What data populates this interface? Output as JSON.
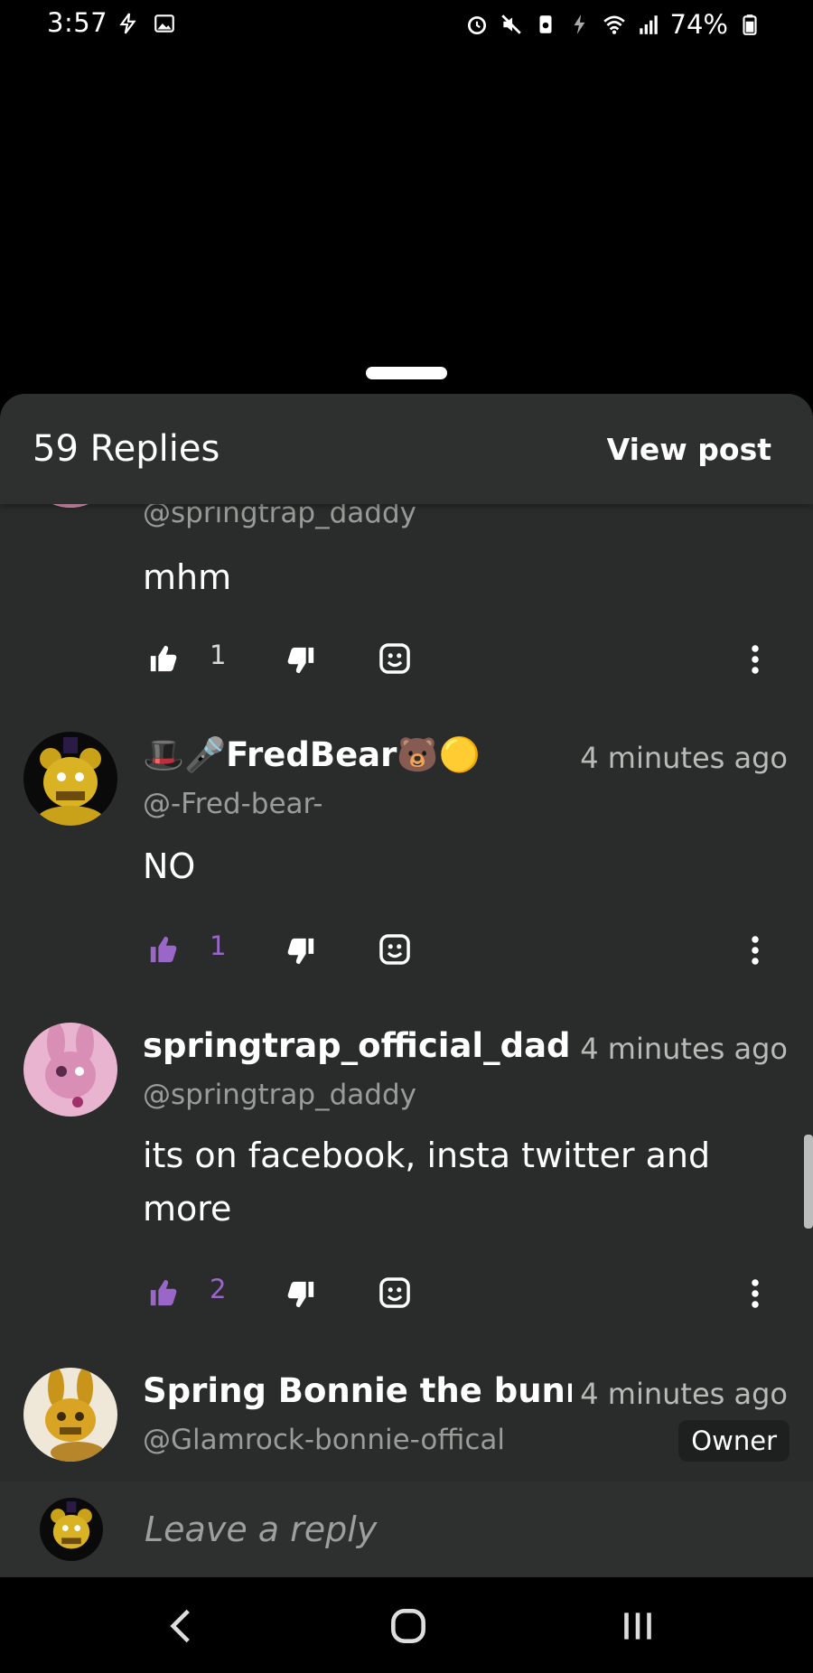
{
  "status_bar": {
    "time": "3:57",
    "battery": "74%"
  },
  "header": {
    "replies_count": "59 Replies",
    "view_post": "View post"
  },
  "comments": [
    {
      "name": "",
      "handle": "@springtrap_daddy",
      "time": "",
      "body": "mhm",
      "likes": "1",
      "liked": false
    },
    {
      "name": "🎩🎤FredBear🐻🟡",
      "handle": "@-Fred-bear-",
      "time": "4 minutes ago",
      "body": "NO",
      "likes": "1",
      "liked": true
    },
    {
      "name": "springtrap_official_daddy",
      "handle": "@springtrap_daddy",
      "time": "4 minutes ago",
      "body": "its on facebook, insta twitter and more",
      "likes": "2",
      "liked": true
    },
    {
      "name": "Spring Bonnie the bunny",
      "handle": "@Glamrock-bonnie-offical",
      "time": "4 minutes ago",
      "badge": "Owner"
    }
  ],
  "reply_bar": {
    "placeholder": "Leave a reply"
  },
  "colors": {
    "sheet_bg": "#2a2c2b",
    "header_bg": "#2e302f",
    "accent_purple": "#9a66c8",
    "muted_text": "#9a9c9a"
  },
  "icons": [
    "alarm-icon",
    "mute-icon",
    "sync-icon",
    "charging-icon",
    "wifi-icon",
    "signal-icon",
    "battery-icon",
    "like-icon",
    "dislike-icon",
    "react-icon",
    "more-icon",
    "back-icon",
    "home-icon",
    "recents-icon"
  ]
}
